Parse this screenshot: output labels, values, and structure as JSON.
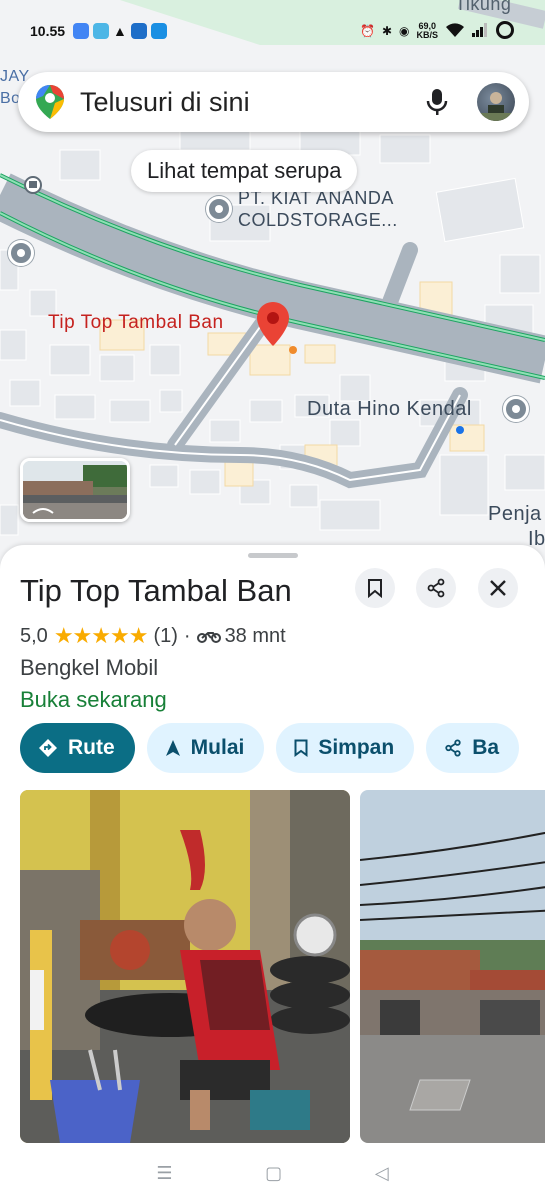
{
  "status": {
    "time": "10.55",
    "net_speed_value": "69,0",
    "net_speed_unit": "KB/S"
  },
  "search": {
    "placeholder": "Telusuri di sini",
    "icons": [
      "maps-pin-icon",
      "mic-icon",
      "avatar"
    ]
  },
  "map": {
    "similar_chip": "Lihat tempat serupa",
    "labels": {
      "kiat_line1": "PT. KIAT ANANDA",
      "kiat_line2": "COLDSTORAGE...",
      "selected": "Tip Top Tambal Ban",
      "duta": "Duta Hino Kendal",
      "penja": "Penja",
      "ib": "Ib",
      "top_right": "Tikung",
      "top_left_a": "JAY",
      "top_left_b": "Bo"
    },
    "colors": {
      "road": "#aab4be",
      "highlight": "#1ea362",
      "selected_pin": "#ea4335"
    }
  },
  "place": {
    "name": "Tip Top Tambal Ban",
    "rating": "5,0",
    "stars": "★★★★★",
    "reviews": "(1)",
    "separator": "·",
    "travel_time": "38 mnt",
    "category": "Bengkel Mobil",
    "open_status": "Buka sekarang",
    "actions": [
      {
        "label": "Rute",
        "icon": "directions-icon"
      },
      {
        "label": "Mulai",
        "icon": "navigation-arrow-icon"
      },
      {
        "label": "Simpan",
        "icon": "bookmark-icon"
      },
      {
        "label": "Ba",
        "icon": "share-icon"
      }
    ]
  },
  "navbar": {
    "recents": "☰",
    "home": "▢",
    "back": "◁"
  }
}
